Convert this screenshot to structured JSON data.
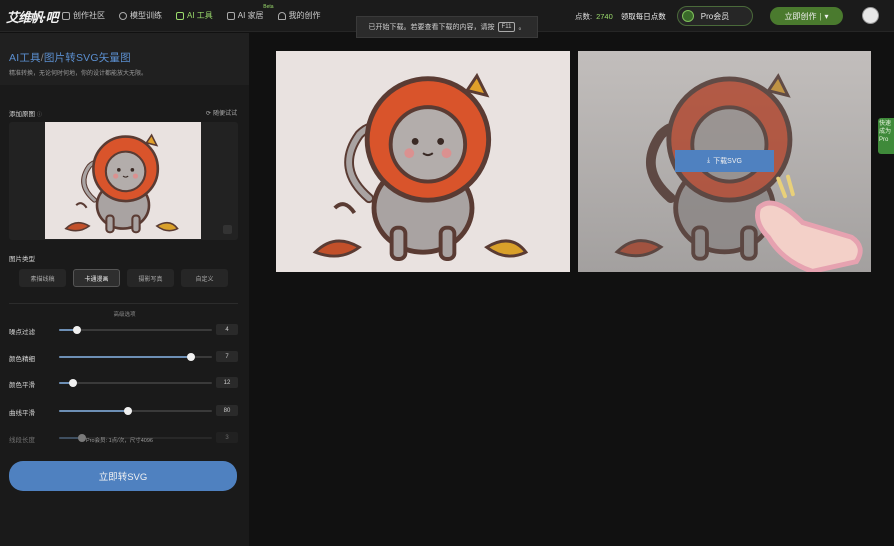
{
  "header": {
    "logo_text": "艾维帆·吧",
    "nav": [
      {
        "label": "创作社区",
        "active": false,
        "icon": "community-icon"
      },
      {
        "label": "模型训练",
        "active": false,
        "icon": "model-icon"
      },
      {
        "label": "AI 工具",
        "active": true,
        "icon": "tools-icon"
      },
      {
        "label": "AI 家居",
        "active": false,
        "icon": "home-icon",
        "badge": "Beta"
      },
      {
        "label": "我的创作",
        "active": false,
        "icon": "heart-icon"
      }
    ],
    "points_label": "点数:",
    "points_value": "2740",
    "claim_label": "领取每日点数",
    "pro_label": "Pro会员",
    "create_label": "立即创作",
    "create_caret": "▾"
  },
  "notice": {
    "text_before": "已开始下载。若要查看下载的内容，请按",
    "key": "F11",
    "text_after": "。"
  },
  "sidebar": {
    "title_prefix": "AI工具",
    "title_slash": "/",
    "title": "图片转SVG矢量图",
    "subtitle": "精准转换，无论何时何地，你的设计都能放大无限。",
    "upload_label": "添加原图",
    "example_link": "随便试试",
    "type_label": "图片类型",
    "types": [
      "素描线稿",
      "卡通漫画",
      "摄影写真",
      "自定义"
    ],
    "selected_type": "卡通漫画",
    "advanced_label": "高级选项",
    "sliders": [
      {
        "label": "噪点过滤",
        "value": "4",
        "level": 0.12
      },
      {
        "label": "颜色精细",
        "value": "7",
        "level": 0.86
      },
      {
        "label": "颜色平滑",
        "value": "12",
        "level": 0.09
      },
      {
        "label": "曲线平滑",
        "value": "80",
        "level": 0.45
      },
      {
        "label": "线段长度",
        "value": "3",
        "level": 0.15,
        "dim": true
      }
    ],
    "pro_note": "Pro会员: 1点/次，尺寸4096",
    "convert_label": "立即转SVG"
  },
  "preview": {
    "download_label": "下载SVG"
  },
  "side_tab": {
    "text": "快速成为Pro"
  },
  "colors": {
    "accent_blue": "#4f81c0",
    "accent_green": "#9bdc6c",
    "mane": "#d9542b",
    "cat_fur": "#a9a3a2"
  }
}
